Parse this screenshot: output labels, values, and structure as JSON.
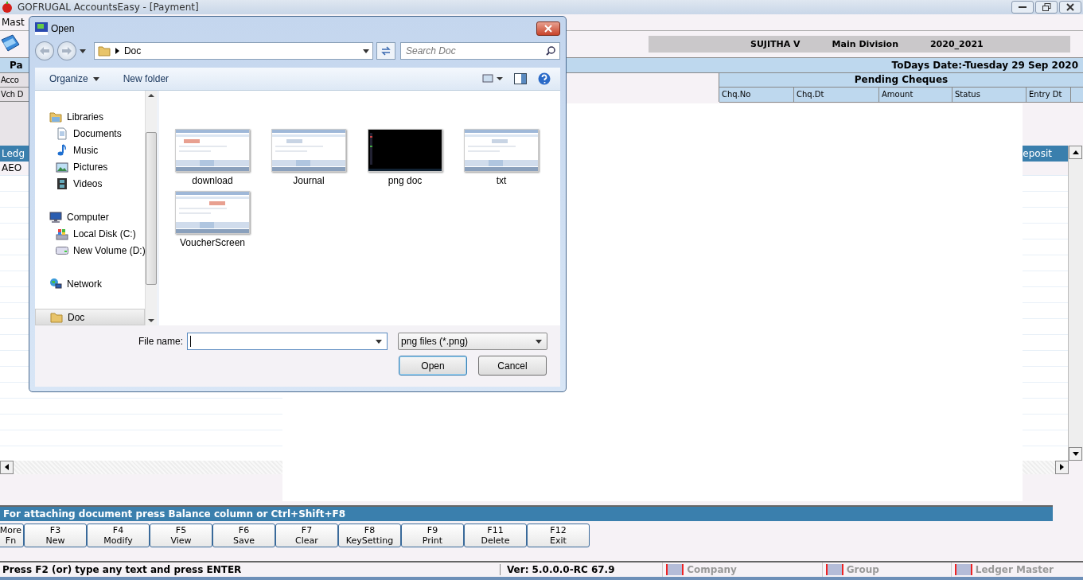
{
  "app": {
    "title": "GOFRUGAL AccountsEasy - [Payment]",
    "menu": [
      "Mast"
    ],
    "company": {
      "user": "SUJITHA V",
      "division": "Main Division",
      "year": "2020_2021"
    },
    "date": "ToDays Date:-Tuesday 29 Sep 2020",
    "panel_title": "Pa",
    "field_labels": [
      "Acco",
      "Vch D"
    ],
    "pending_cheques": {
      "title": "Pending Cheques",
      "columns": [
        "Chq.No",
        "Chq.Dt",
        "Amount",
        "Status",
        "Entry Dt"
      ]
    },
    "ledger": {
      "columns": [
        "Ledg",
        "eposit"
      ],
      "rows": [
        [
          "AEO"
        ]
      ]
    },
    "hint": "For attaching document press Balance column or Ctrl+Shift+F8",
    "function_keys": [
      {
        "key": "More",
        "label": "Fn"
      },
      {
        "key": "F3",
        "label": "New"
      },
      {
        "key": "F4",
        "label": "Modify"
      },
      {
        "key": "F5",
        "label": "View"
      },
      {
        "key": "F6",
        "label": "Save"
      },
      {
        "key": "F7",
        "label": "Clear"
      },
      {
        "key": "F8",
        "label": "KeySetting"
      },
      {
        "key": "F9",
        "label": "Print"
      },
      {
        "key": "F11",
        "label": "Delete"
      },
      {
        "key": "F12",
        "label": "Exit"
      }
    ],
    "status_bar": {
      "message": "Press F2 (or) type any text and press ENTER",
      "version": "Ver: 5.0.0.0-RC 67.9",
      "shortcuts": [
        "Company",
        "Group",
        "Ledger Master"
      ]
    }
  },
  "dialog": {
    "title": "Open",
    "address": "Doc",
    "search": {
      "placeholder": "Search Doc"
    },
    "toolbar": [
      "Organize",
      "New folder"
    ],
    "nav": [
      {
        "label": "Libraries",
        "kind": "library",
        "selected": false,
        "children": [
          {
            "label": "Documents",
            "kind": "document",
            "selected": false
          },
          {
            "label": "Music",
            "kind": "music",
            "selected": false
          },
          {
            "label": "Pictures",
            "kind": "pictures",
            "selected": false
          },
          {
            "label": "Videos",
            "kind": "videos",
            "selected": false
          }
        ]
      },
      {
        "label": "Computer",
        "kind": "computer",
        "selected": false,
        "children": [
          {
            "label": "Local Disk (C:)",
            "kind": "disk",
            "selected": false
          },
          {
            "label": "New Volume (D:)",
            "kind": "drive",
            "selected": false
          }
        ]
      },
      {
        "label": "Network",
        "kind": "network",
        "selected": false
      },
      {
        "label": "Doc",
        "kind": "folder",
        "selected": true
      }
    ],
    "files": [
      {
        "name": "download"
      },
      {
        "name": "Journal"
      },
      {
        "name": "png doc"
      },
      {
        "name": "txt"
      },
      {
        "name": "VoucherScreen"
      }
    ],
    "file_name_label": "File name:",
    "file_type": "png files (*.png)",
    "buttons": [
      "Open",
      "Cancel"
    ]
  }
}
